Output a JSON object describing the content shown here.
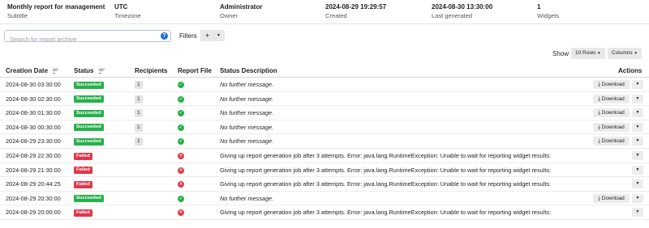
{
  "summary": [
    {
      "value": "Monthly report for management",
      "label": "Subtitle"
    },
    {
      "value": "UTC",
      "label": "Timezone"
    },
    {
      "value": "Administrator",
      "label": "Owner"
    },
    {
      "value": "2024-08-29 19:29:57",
      "label": "Created"
    },
    {
      "value": "2024-08-30 13:30:00",
      "label": "Last generated"
    },
    {
      "value": "1",
      "label": "Widgets"
    }
  ],
  "search": {
    "placeholder": "Search for report archive",
    "help_icon": "?"
  },
  "filters": {
    "label": "Filters",
    "add_label": "+",
    "caret": "▼"
  },
  "controls": {
    "show_label": "Show",
    "rows_label": "10 Rows",
    "columns_label": "Columns",
    "caret": "▼"
  },
  "table": {
    "headers": {
      "date": "Creation Date",
      "status": "Status",
      "recipients": "Recipients",
      "file": "Report File",
      "description": "Status Description",
      "actions": "Actions"
    },
    "rows": [
      {
        "date": "2024-08-30 03:30:00",
        "status": "Succeeded",
        "recipients": "1",
        "file_ok": true,
        "description": "No further message.",
        "download": "Download",
        "more": "▼"
      },
      {
        "date": "2024-08-30 02:30:00",
        "status": "Succeeded",
        "recipients": "1",
        "file_ok": true,
        "description": "No further message.",
        "download": "Download",
        "more": "▼"
      },
      {
        "date": "2024-08-30 01:30:00",
        "status": "Succeeded",
        "recipients": "1",
        "file_ok": true,
        "description": "No further message.",
        "download": "Download",
        "more": "▼"
      },
      {
        "date": "2024-08-30 00:30:00",
        "status": "Succeeded",
        "recipients": "1",
        "file_ok": true,
        "description": "No further message.",
        "download": "Download",
        "more": "▼"
      },
      {
        "date": "2024-08-29 23:30:00",
        "status": "Succeeded",
        "recipients": "1",
        "file_ok": true,
        "description": "No further message.",
        "download": "Download",
        "more": "▼"
      },
      {
        "date": "2024-08-29 22:30:00",
        "status": "Failed",
        "recipients": "",
        "file_ok": false,
        "description": "Giving up report generation job after 3 attempts. Error: java.lang.RuntimeException: Unable to wait for reporting widget results:",
        "download": "",
        "more": "▼"
      },
      {
        "date": "2024-08-29 21:30:00",
        "status": "Failed",
        "recipients": "",
        "file_ok": false,
        "description": "Giving up report generation job after 3 attempts. Error: java.lang.RuntimeException: Unable to wait for reporting widget results:",
        "download": "",
        "more": "▼"
      },
      {
        "date": "2024-08-29 20:44:25",
        "status": "Failed",
        "recipients": "",
        "file_ok": false,
        "description": "Giving up report generation job after 3 attempts. Error: java.lang.RuntimeException: Unable to wait for reporting widget results:",
        "download": "",
        "more": "▼"
      },
      {
        "date": "2024-08-29 20:30:00",
        "status": "Succeeded",
        "recipients": "",
        "file_ok": true,
        "description": "No further message.",
        "download": "Download",
        "more": "▼"
      },
      {
        "date": "2024-08-29 20:00:00",
        "status": "Failed",
        "recipients": "",
        "file_ok": false,
        "description": "Giving up report generation job after 3 attempts. Error: java.lang.RuntimeException: Unable to wait for reporting widget results:",
        "download": "",
        "more": "▼"
      }
    ]
  },
  "colors": {
    "success": "#27b04a",
    "failed": "#e0384a",
    "accent": "#1f6fd1"
  },
  "icons": {
    "sort": "sort-lines-icon",
    "download": "download-icon",
    "file_ok": "check-circle-icon",
    "file_fail": "x-circle-icon",
    "help": "question-circle-icon"
  }
}
